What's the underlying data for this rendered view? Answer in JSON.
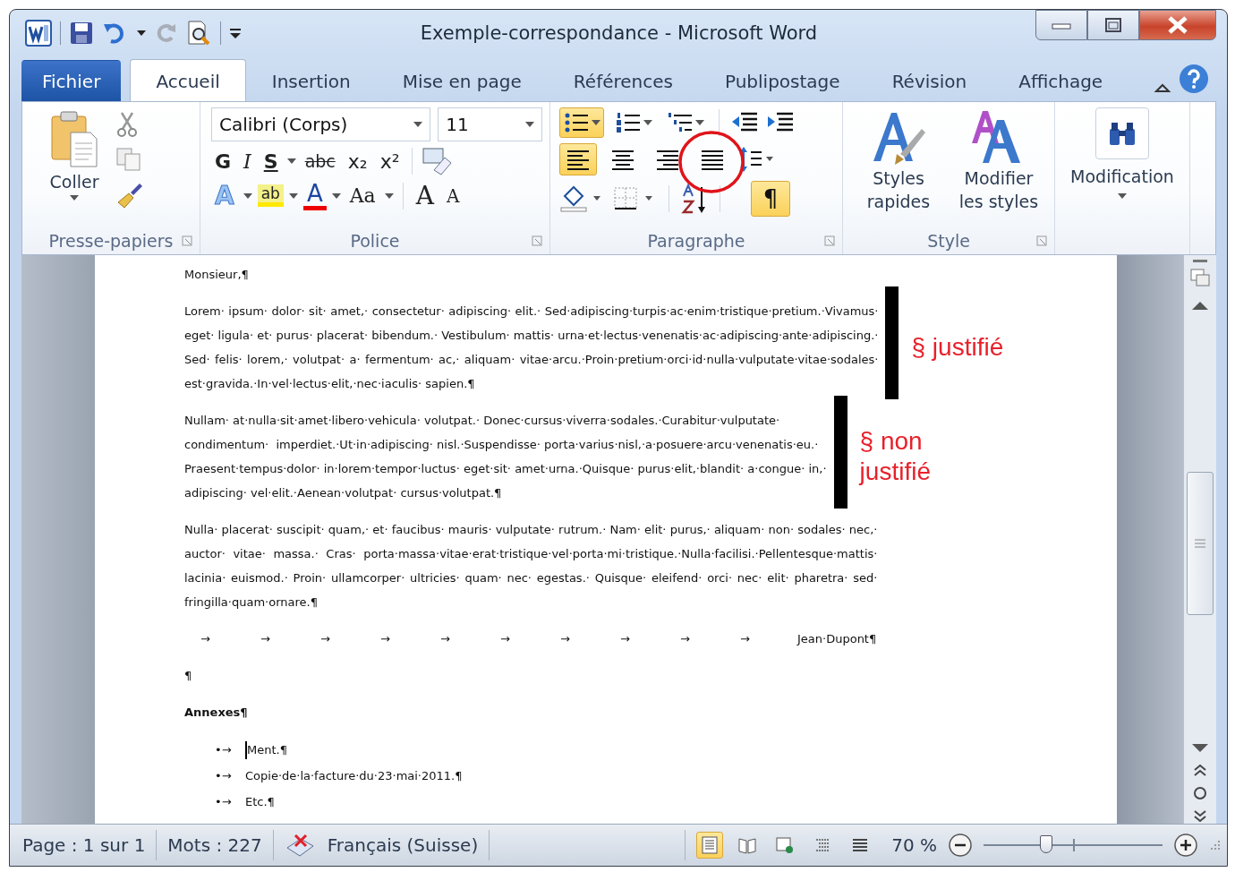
{
  "window": {
    "title": "Exemple-correspondance  -  Microsoft Word"
  },
  "tabs": [
    {
      "label": "Fichier",
      "kind": "file",
      "selected": false
    },
    {
      "label": "Accueil",
      "kind": "tab",
      "selected": true
    },
    {
      "label": "Insertion",
      "kind": "tab",
      "selected": false
    },
    {
      "label": "Mise en page",
      "kind": "tab",
      "selected": false
    },
    {
      "label": "Références",
      "kind": "tab",
      "selected": false
    },
    {
      "label": "Publipostage",
      "kind": "tab",
      "selected": false
    },
    {
      "label": "Révision",
      "kind": "tab",
      "selected": false
    },
    {
      "label": "Affichage",
      "kind": "tab",
      "selected": false
    }
  ],
  "ribbon": {
    "clipboard": {
      "paste_label": "Coller",
      "group_label": "Presse-papiers"
    },
    "font": {
      "font_name": "Calibri (Corps)",
      "font_size": "11",
      "group_label": "Police",
      "format_buttons": [
        {
          "label": "G",
          "kind": "bold"
        },
        {
          "label": "I",
          "kind": "italic"
        },
        {
          "label": "S",
          "kind": "underline"
        },
        {
          "label": "abc",
          "kind": "strike"
        },
        {
          "label": "x₂",
          "kind": "sub"
        },
        {
          "label": "x²",
          "kind": "sup"
        }
      ],
      "color_buttons": [
        {
          "label": "A",
          "kind": "effects"
        },
        {
          "label": "ab",
          "kind": "highlight"
        },
        {
          "label": "A",
          "kind": "font_color"
        },
        {
          "label": "Aa",
          "kind": "case"
        },
        {
          "label": "A",
          "kind": "grow"
        },
        {
          "label": "A",
          "kind": "shrink"
        }
      ]
    },
    "paragraph": {
      "group_label": "Paragraphe",
      "list_buttons": [
        {
          "kind": "bullets",
          "selected": true
        },
        {
          "kind": "numbering",
          "selected": false
        },
        {
          "kind": "multilevel",
          "selected": false
        }
      ],
      "align_buttons": [
        {
          "kind": "left",
          "selected": true
        },
        {
          "kind": "center",
          "selected": false
        },
        {
          "kind": "right",
          "selected": false
        },
        {
          "kind": "justify",
          "selected": false,
          "circled": true
        }
      ],
      "show_marks": {
        "label": "¶",
        "selected": true
      }
    },
    "styles": {
      "group_label": "Style",
      "buttons": [
        {
          "label": "Styles rapides",
          "kind": "quick"
        },
        {
          "label": "Modifier les styles",
          "kind": "change"
        }
      ]
    },
    "editing": {
      "label": "Modification"
    }
  },
  "document": {
    "paragraphs": [
      {
        "kind": "text",
        "bold": false,
        "lines": [
          "Monsieur,¶"
        ]
      },
      {
        "kind": "text",
        "bold": false,
        "justified": true,
        "note": "§ justifié",
        "lines": [
          "Lorem· ipsum· dolor· sit· amet,· consectetur· adipiscing· elit.· Sed·adipiscing·turpis·ac·enim·tristique·pretium.·Vivamus·",
          "eget· ligula· et· purus· placerat· bibendum.· Vestibulum· mattis· urna·et·lectus·venenatis·ac·adipiscing·ante·adipiscing.·",
          "Sed· felis· lorem,· volutpat· a· fermentum· ac,· aliquam· vitae·arcu.·Proin·pretium·orci·id·nulla·vulputate·vitae·sodales·",
          "est·gravida.·In·vel·lectus·elit,·nec·iaculis· sapien.¶"
        ]
      },
      {
        "kind": "text",
        "bold": false,
        "justified": false,
        "note": "§ non justifié",
        "lines": [
          "Nullam· at·nulla·sit·amet·libero·vehicula· volutpat.· Donec·cursus·viverra·sodales.·Curabitur·vulputate·",
          "condimentum·  imperdiet.·Ut·in·adipiscing· nisl.·Suspendisse· porta·varius·nisl,·a·posuere·arcu·venenatis·eu.·",
          "Praesent·tempus·dolor· in·lorem·tempor·luctus· eget·sit· amet·urna.·Quisque· purus·elit,·blandit· a·congue· in,·",
          "adipiscing· vel·elit.·Aenean·volutpat· cursus·volutpat.¶"
        ]
      },
      {
        "kind": "text",
        "bold": false,
        "justified": true,
        "lines": [
          "Nulla· placerat· suscipit· quam,· et· faucibus· mauris· vulputate· rutrum.· Nam· elit· purus,· aliquam· non· sodales· nec,·",
          "auctor· vitae· massa.· Cras· porta·massa·vitae·erat·tristique·vel·porta·mi·tristique.·Nulla·facilisi.·Pellentesque·mattis·",
          "lacinia· euismod.· Proin· ullamcorper· ultricies· quam· nec· egestas.· Quisque· eleifend· orci· nec· elit· pharetra· sed·",
          "fringilla·quam·ornare.¶"
        ]
      },
      {
        "kind": "tabbed",
        "tab_marks": [
          "→",
          "→",
          "→",
          "→",
          "→",
          "→",
          "→",
          "→",
          "→",
          "→"
        ],
        "text": "Jean·Dupont¶"
      },
      {
        "kind": "text",
        "bold": false,
        "lines": [
          "¶"
        ]
      },
      {
        "kind": "text",
        "bold": true,
        "lines": [
          "Annexes¶"
        ]
      },
      {
        "kind": "list",
        "items": [
          {
            "marker": "•→",
            "text": "Ment.¶",
            "cursor": true
          },
          {
            "marker": "•→",
            "text": "Copie·de·la·facture·du·23·mai·2011.¶",
            "cursor": false
          },
          {
            "marker": "•→",
            "text": "Etc.¶",
            "cursor": false
          }
        ]
      }
    ]
  },
  "status_bar": {
    "page": "Page : 1 sur 1",
    "words": "Mots : 227",
    "language": "Français (Suisse)",
    "views": [
      {
        "kind": "print",
        "selected": true
      },
      {
        "kind": "reading",
        "selected": false
      },
      {
        "kind": "web",
        "selected": false
      },
      {
        "kind": "outline",
        "selected": false
      },
      {
        "kind": "draft",
        "selected": false
      }
    ],
    "zoom": "70 %",
    "zoom_slider": {
      "level": 0.35
    }
  }
}
